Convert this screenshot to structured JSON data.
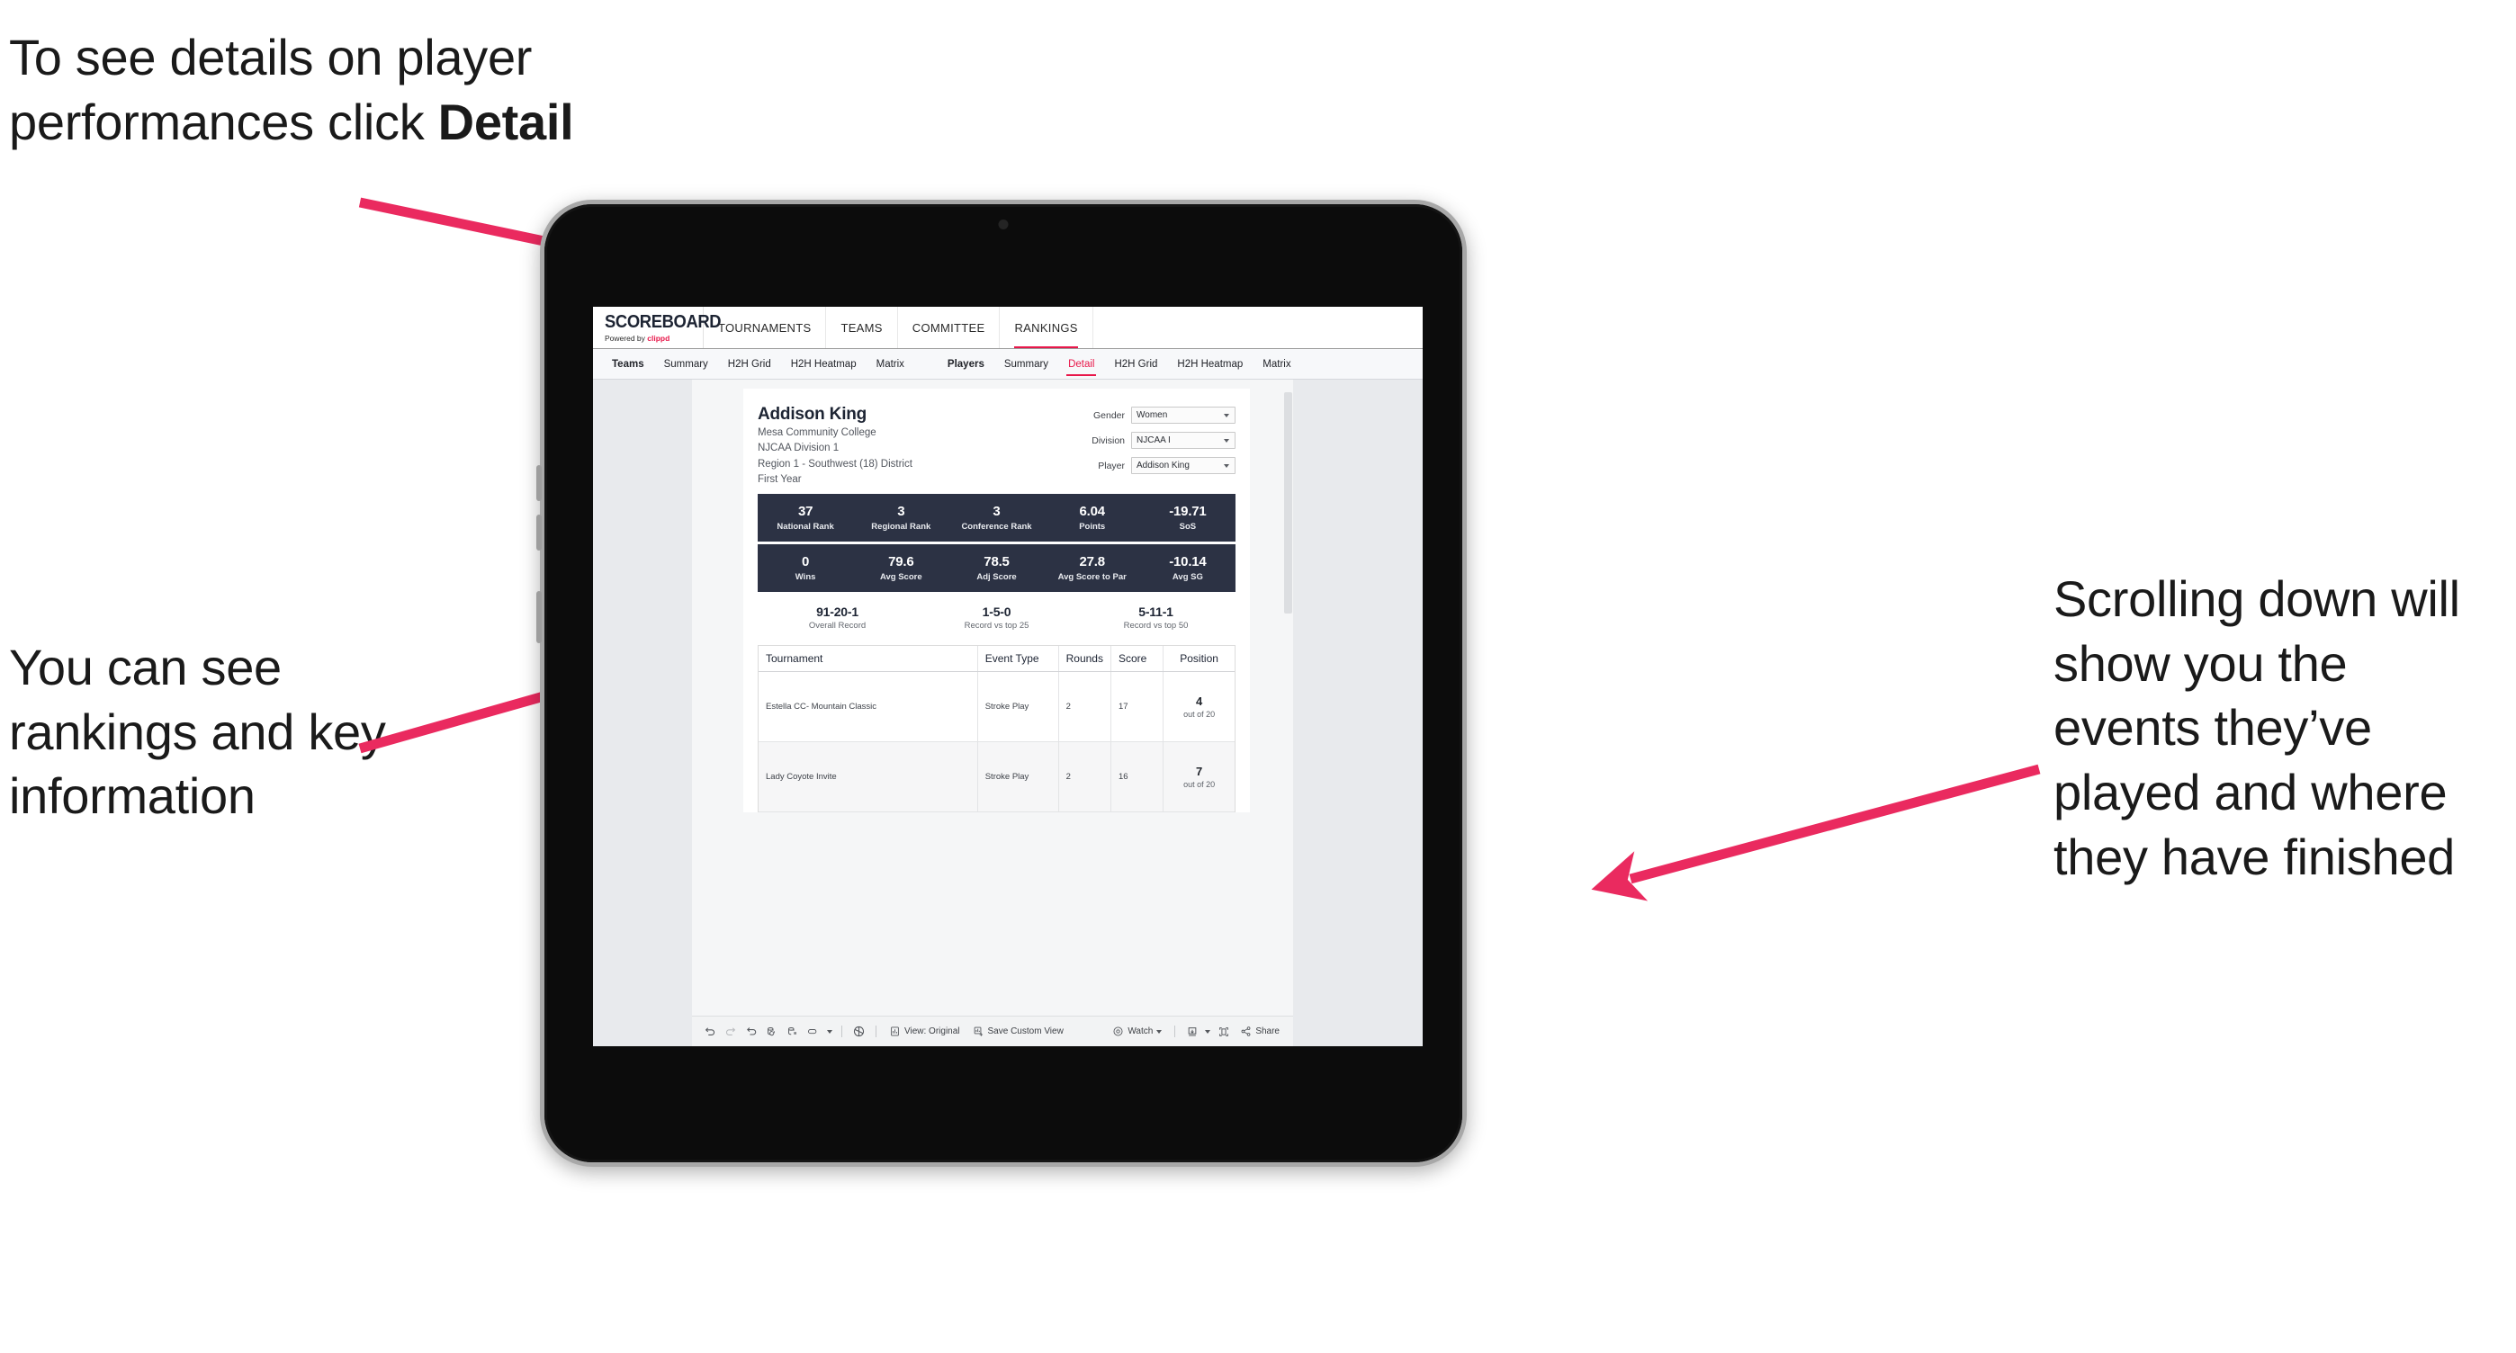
{
  "annotations": {
    "top_left": "To see details on player performances click ",
    "top_left_bold": "Detail",
    "mid_left": "You can see rankings and key information",
    "right": "Scrolling down will show you the events they’ve played and where they have finished",
    "arrow_color": "#ea2a5f"
  },
  "app": {
    "brand": {
      "name": "SCOREBOARD",
      "sub_prefix": "Powered by ",
      "sub_brand": "clippd"
    },
    "top_nav": [
      {
        "label": "TOURNAMENTS",
        "active": false
      },
      {
        "label": "TEAMS",
        "active": false
      },
      {
        "label": "COMMITTEE",
        "active": false
      },
      {
        "label": "RANKINGS",
        "active": true
      }
    ],
    "tab_groups": [
      {
        "group_label": "Teams",
        "tabs": [
          {
            "label": "Summary",
            "active": false
          },
          {
            "label": "H2H Grid",
            "active": false
          },
          {
            "label": "H2H Heatmap",
            "active": false
          },
          {
            "label": "Matrix",
            "active": false
          }
        ]
      },
      {
        "group_label": "Players",
        "tabs": [
          {
            "label": "Summary",
            "active": false
          },
          {
            "label": "Detail",
            "active": true
          },
          {
            "label": "H2H Grid",
            "active": false
          },
          {
            "label": "H2H Heatmap",
            "active": false
          },
          {
            "label": "Matrix",
            "active": false
          }
        ]
      }
    ]
  },
  "player": {
    "name": "Addison King",
    "school": "Mesa Community College",
    "division": "NJCAA Division 1",
    "region": "Region 1 - Southwest (18) District",
    "year": "First Year"
  },
  "filters": [
    {
      "label": "Gender",
      "value": "Women"
    },
    {
      "label": "Division",
      "value": "NJCAA I"
    },
    {
      "label": "Player",
      "value": "Addison King"
    }
  ],
  "stats_row_1": [
    {
      "value": "37",
      "label": "National Rank"
    },
    {
      "value": "3",
      "label": "Regional Rank"
    },
    {
      "value": "3",
      "label": "Conference Rank"
    },
    {
      "value": "6.04",
      "label": "Points"
    },
    {
      "value": "-19.71",
      "label": "SoS"
    }
  ],
  "stats_row_2": [
    {
      "value": "0",
      "label": "Wins"
    },
    {
      "value": "79.6",
      "label": "Avg Score"
    },
    {
      "value": "78.5",
      "label": "Adj Score"
    },
    {
      "value": "27.8",
      "label": "Avg Score to Par"
    },
    {
      "value": "-10.14",
      "label": "Avg SG"
    }
  ],
  "records": [
    {
      "value": "91-20-1",
      "label": "Overall Record"
    },
    {
      "value": "1-5-0",
      "label": "Record vs top 25"
    },
    {
      "value": "5-11-1",
      "label": "Record vs top 50"
    }
  ],
  "tournament_table": {
    "headers": [
      "Tournament",
      "Event Type",
      "Rounds",
      "Score",
      "Position"
    ],
    "rows": [
      {
        "tournament": "Estella CC- Mountain Classic",
        "event_type": "Stroke Play",
        "rounds": "2",
        "score": "17",
        "position_num": "4",
        "position_sub": "out of 20"
      },
      {
        "tournament": "Lady Coyote Invite",
        "event_type": "Stroke Play",
        "rounds": "2",
        "score": "16",
        "position_num": "7",
        "position_sub": "out of 20"
      }
    ]
  },
  "toolbar": {
    "view_label": "View: Original",
    "save_label": "Save Custom View",
    "watch_label": "Watch",
    "share_label": "Share"
  },
  "colors": {
    "accent": "#e8174a",
    "stat_band": "#2c3244",
    "arrow": "#ea2a5f"
  }
}
